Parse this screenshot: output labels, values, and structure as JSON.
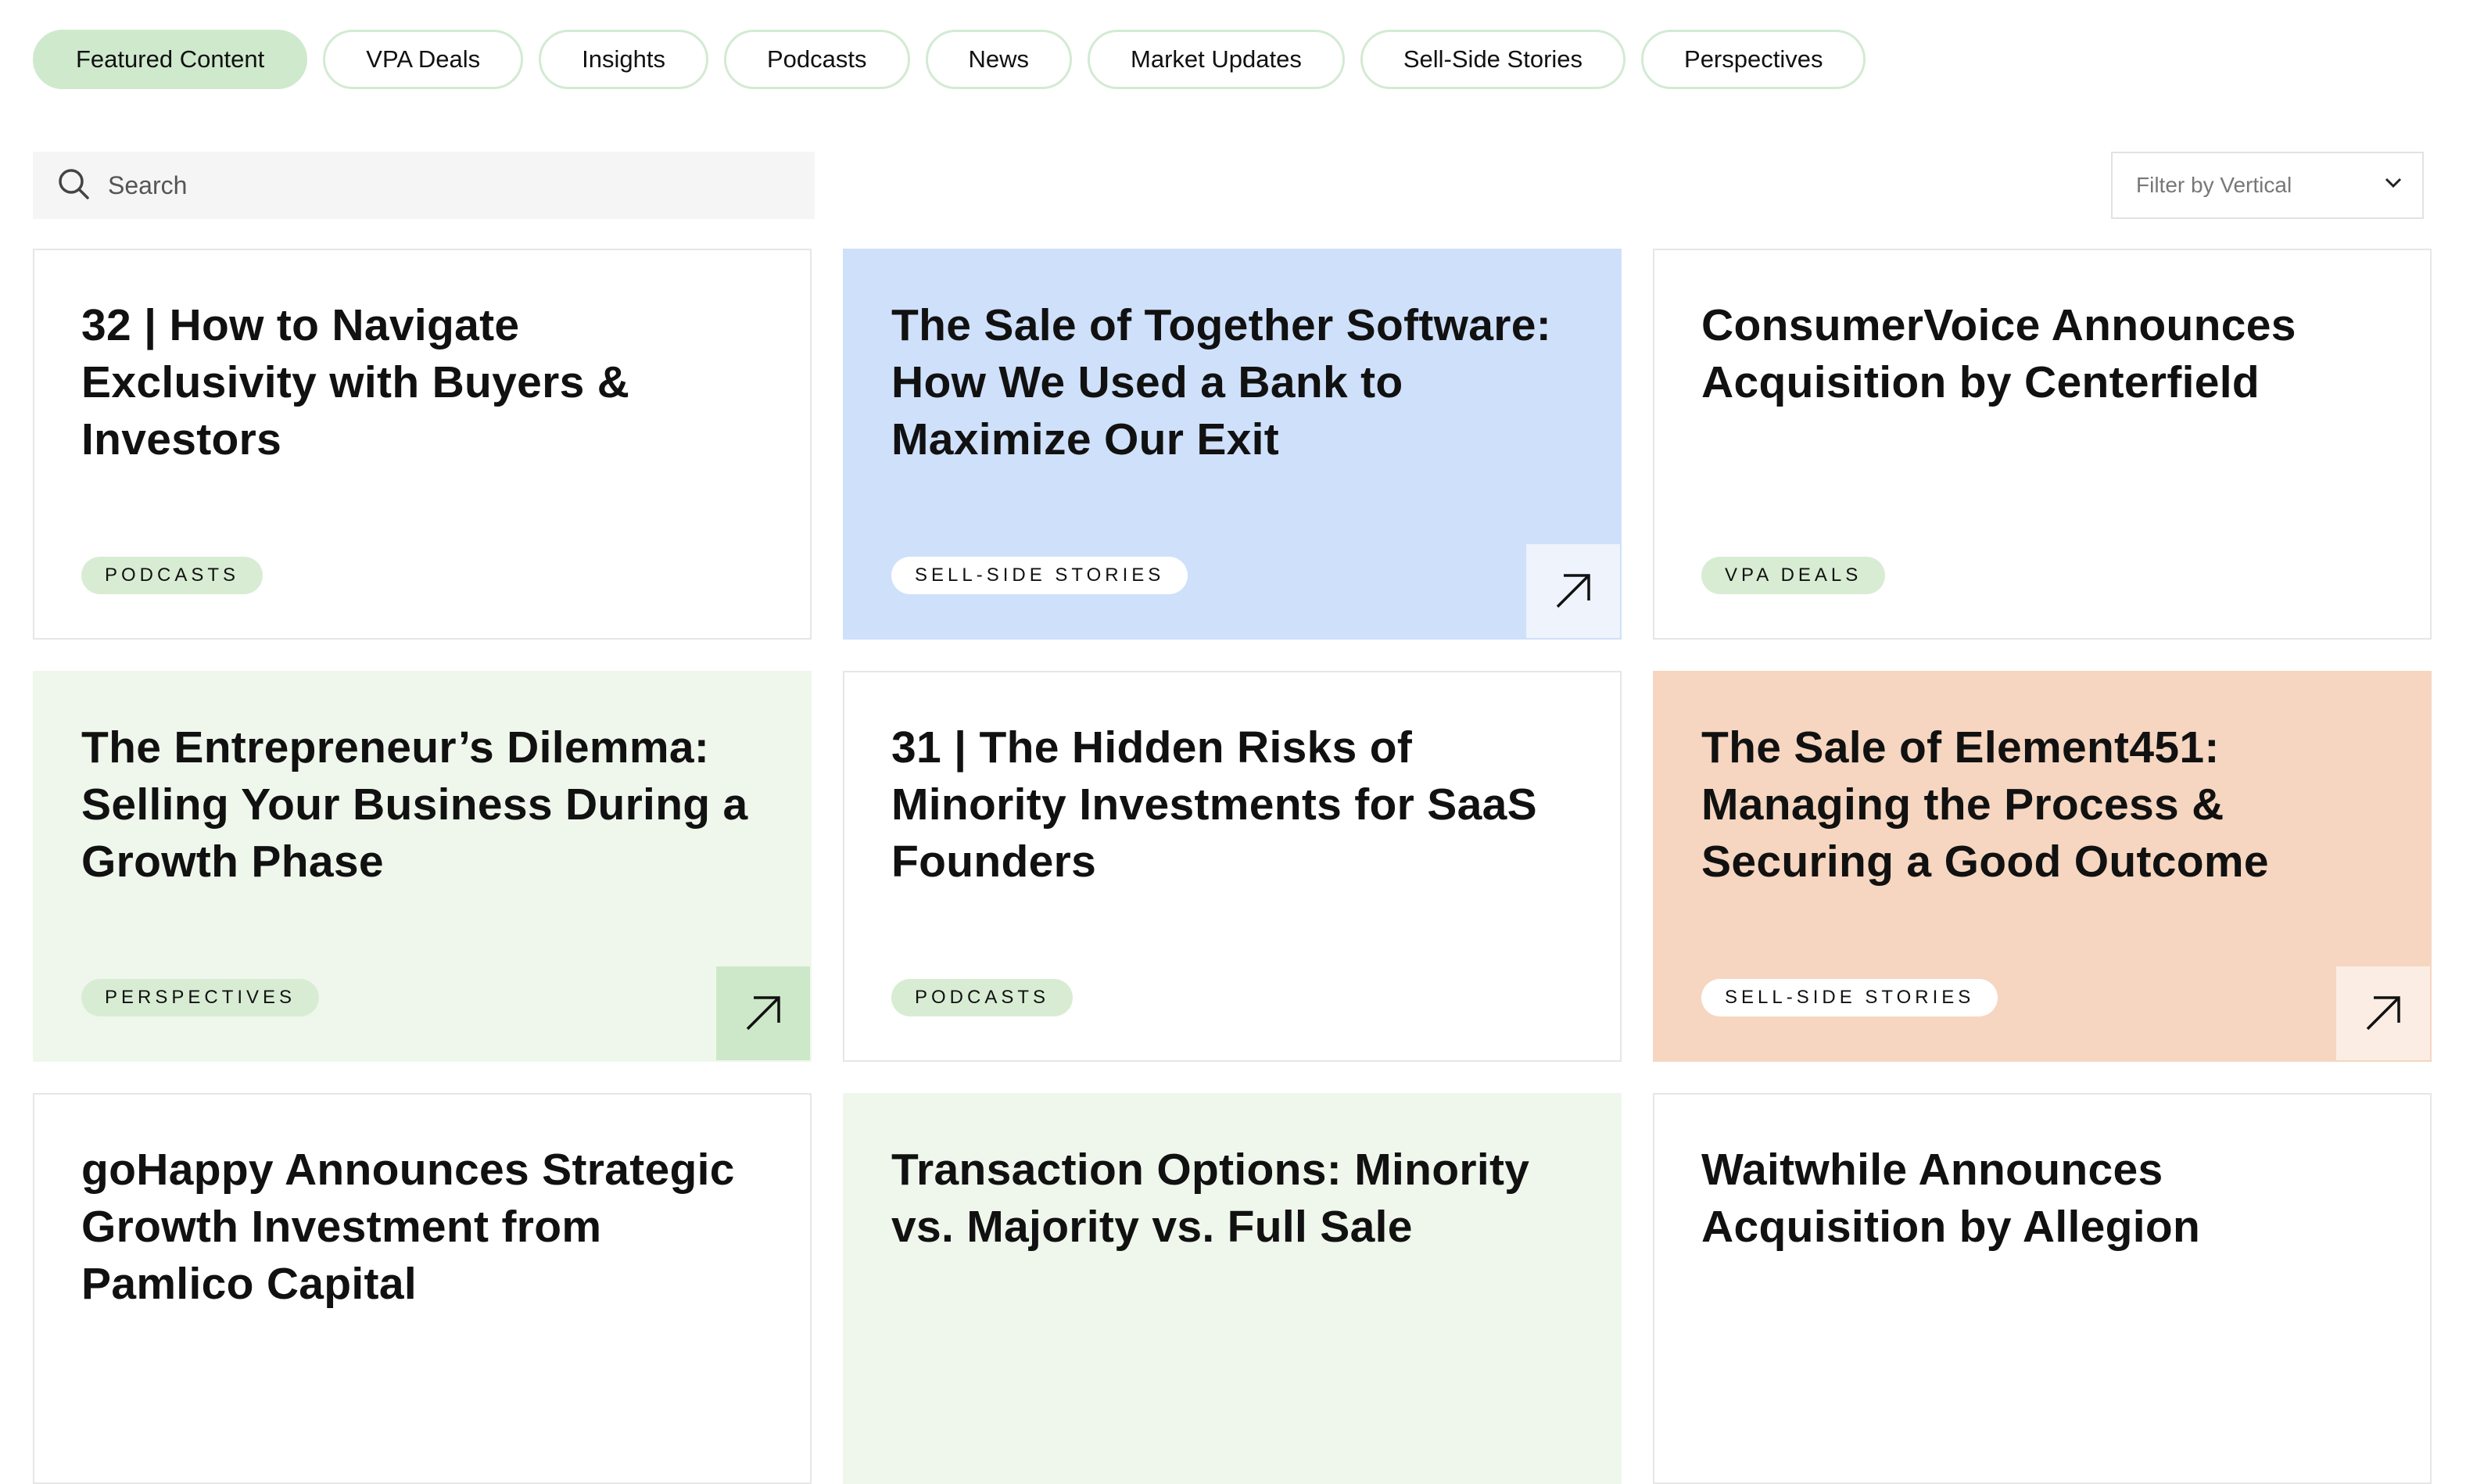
{
  "tabs": [
    {
      "label": "Featured Content",
      "active": true
    },
    {
      "label": "VPA Deals"
    },
    {
      "label": "Insights"
    },
    {
      "label": "Podcasts"
    },
    {
      "label": "News"
    },
    {
      "label": "Market Updates"
    },
    {
      "label": "Sell-Side Stories"
    },
    {
      "label": "Perspectives"
    }
  ],
  "search": {
    "placeholder": "Search",
    "icon": "search-icon"
  },
  "filter": {
    "label": "Filter by Vertical",
    "icon": "chevron-down-icon"
  },
  "colors": {
    "active_tab": "#cfe9cd",
    "blue_card": "#cfe0fb",
    "green_card": "#eff7ec",
    "peach_card": "#f6d6c0",
    "badge": "#d8ecd4"
  },
  "cards": [
    {
      "title": "32 | How to Navigate Exclusivity with Buyers & Investors",
      "tag": "PODCASTS",
      "style": "white"
    },
    {
      "title": "The Sale of Together Software: How We Used a Bank to Maximize Our Exit",
      "tag": "SELL-SIDE STORIES",
      "style": "blue",
      "arrow": "arrow-up-right-icon"
    },
    {
      "title": "ConsumerVoice Announces Acquisition by Centerfield",
      "tag": "VPA DEALS",
      "style": "white"
    },
    {
      "title": "The Entrepreneur’s Dilemma: Selling Your Business During a Growth Phase",
      "tag": "PERSPECTIVES",
      "style": "green",
      "arrow": "arrow-up-right-icon"
    },
    {
      "title": "31 | The Hidden Risks of Minority Investments for SaaS Founders",
      "tag": "PODCASTS",
      "style": "white"
    },
    {
      "title": "The Sale of Element451: Managing the Process & Securing a Good Outcome",
      "tag": "SELL-SIDE STORIES",
      "style": "peach",
      "arrow": "arrow-up-right-icon"
    },
    {
      "title": "goHappy Announces Strategic Growth Investment from Pamlico Capital",
      "style": "white"
    },
    {
      "title": "Transaction Options: Minority vs. Majority vs. Full Sale",
      "style": "green"
    },
    {
      "title": "Waitwhile Announces Acquisition by Allegion",
      "style": "white"
    }
  ]
}
